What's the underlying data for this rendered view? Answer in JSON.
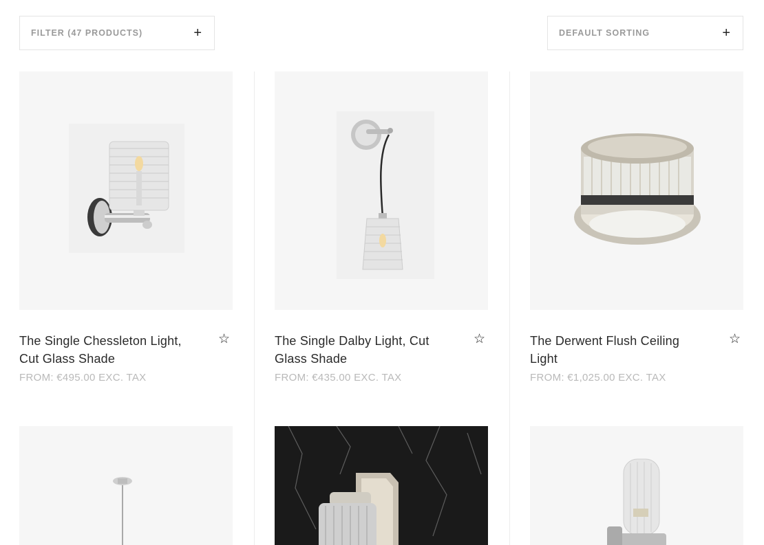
{
  "toolbar": {
    "filter_label": "FILTER (47 PRODUCTS)",
    "filter_icon": "plus-icon",
    "sort_label": "DEFAULT SORTING",
    "sort_icon": "plus-icon"
  },
  "products": [
    {
      "title": "The Single Chessleton Light, Cut Glass Shade",
      "price": "FROM: €495.00 EXC. TAX",
      "wishlist_icon": "star-outline-icon"
    },
    {
      "title": "The Single Dalby Light, Cut Glass Shade",
      "price": "FROM: €435.00 EXC. TAX",
      "wishlist_icon": "star-outline-icon"
    },
    {
      "title": "The Derwent Flush Ceiling Light",
      "price": "FROM: €1,025.00 EXC. TAX",
      "wishlist_icon": "star-outline-icon"
    }
  ],
  "colors": {
    "border": "#e4e4e4",
    "image_bg": "#f6f6f6",
    "muted_text": "#b9b9b9",
    "dark_marble": "#1a1a1a"
  }
}
